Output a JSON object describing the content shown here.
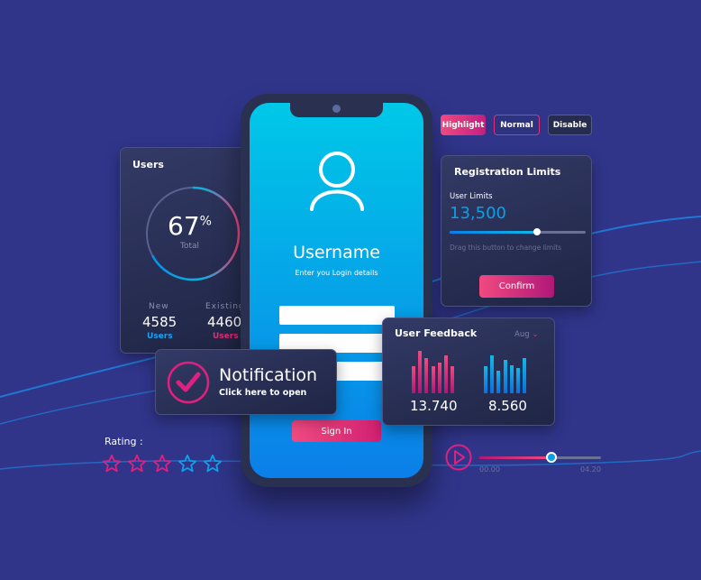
{
  "colors": {
    "background": "#30358a",
    "accent_pink": "#f0407a",
    "accent_blue": "#0aa0e8"
  },
  "users_card": {
    "title": "Users",
    "percent": "67",
    "percent_sign": "%",
    "total_label": "Total",
    "progress": 0.67,
    "new": {
      "label": "New",
      "value": "4585",
      "unit": "Users"
    },
    "existing": {
      "label": "Existing",
      "value": "4460",
      "unit": "Users"
    }
  },
  "notification": {
    "title": "Notification",
    "subtitle": "Click here to open",
    "icon": "check-circle-icon"
  },
  "phone": {
    "icon": "user-icon",
    "title": "Username",
    "subtitle": "Enter you Login details",
    "sign_in": "Sign In"
  },
  "buttons": {
    "highlight": "Highlight",
    "normal": "Normal",
    "disable": "Disable"
  },
  "registration": {
    "title": "Registration Limits",
    "label": "User Limits",
    "value": "13,500",
    "slider_level": 0.64,
    "hint": "Drag this button to change limits",
    "confirm": "Confirm"
  },
  "feedback": {
    "title": "User Feedback",
    "month": "Aug",
    "pink_value": "13.740",
    "blue_value": "8.560",
    "pink_bars": [
      90,
      140,
      117,
      90,
      100,
      125,
      90
    ],
    "blue_bars": [
      90,
      125,
      75,
      110,
      93,
      82,
      115
    ]
  },
  "player": {
    "start": "00.00",
    "end": "04.20",
    "progress": 0.59
  },
  "rating": {
    "label": "Rating :",
    "stars": 5,
    "filled": 3
  }
}
